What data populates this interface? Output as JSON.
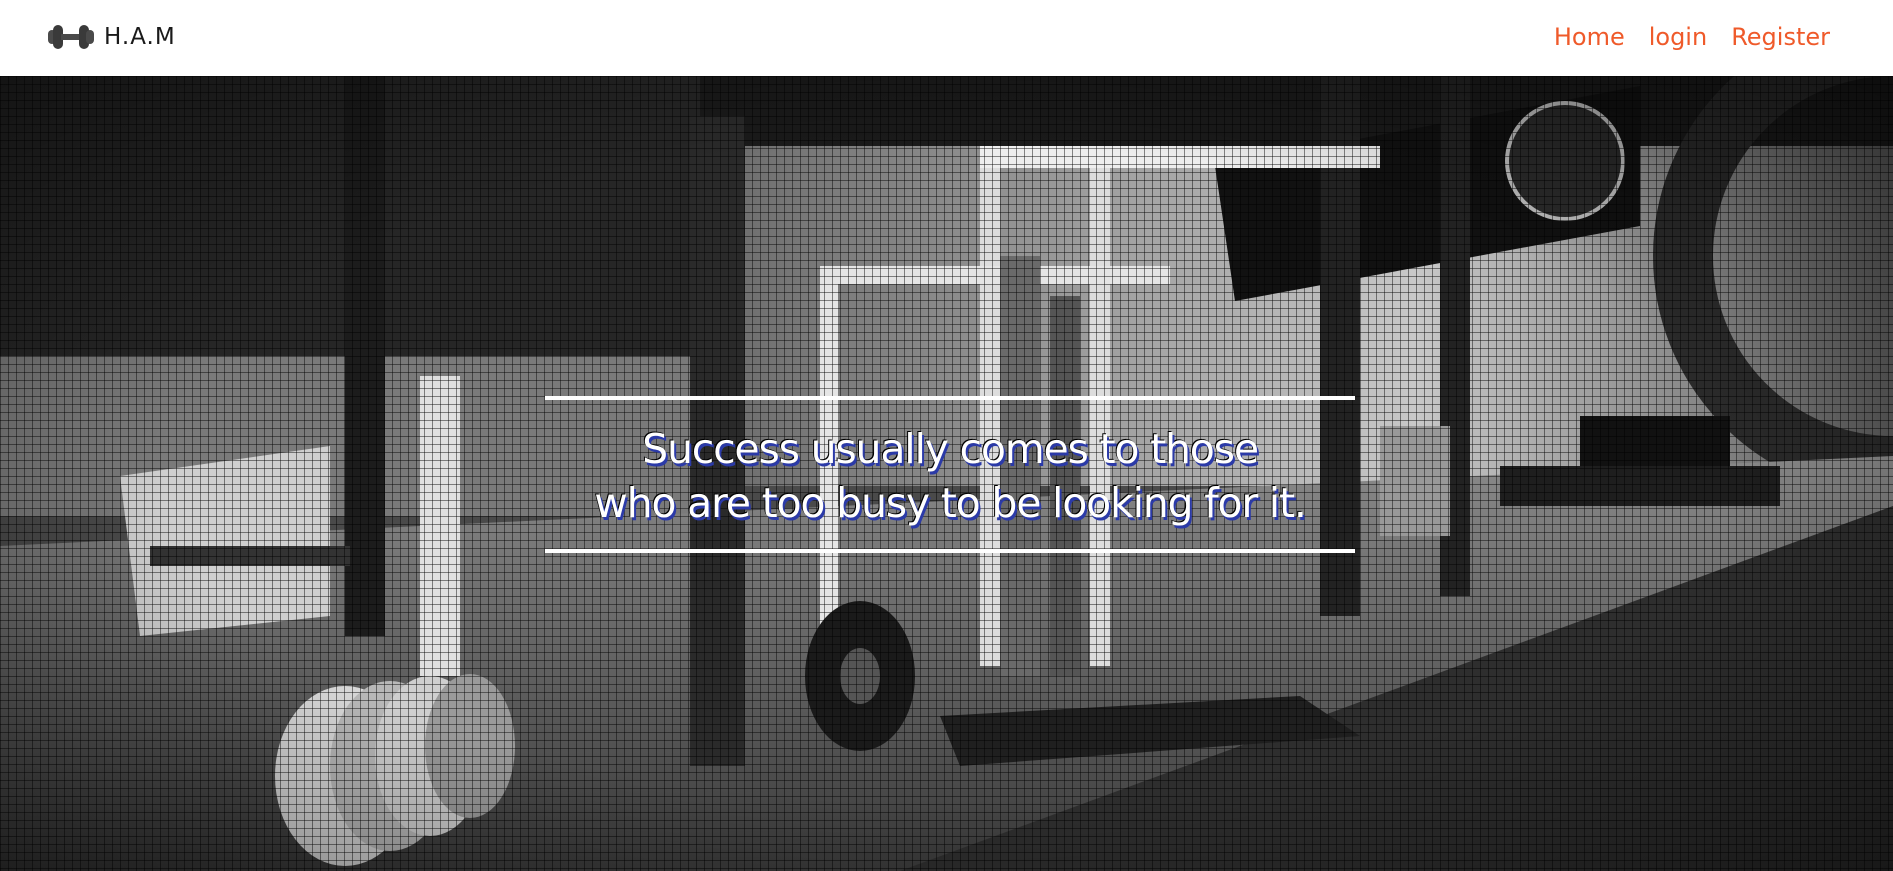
{
  "header": {
    "brand_text": "H.A.M",
    "logo_icon": "dumbbell-icon",
    "nav": [
      {
        "label": "Home"
      },
      {
        "label": "login"
      },
      {
        "label": "Register"
      }
    ],
    "link_color": "#ef5a2a"
  },
  "hero": {
    "background": "grayscale gym photograph",
    "quote_line_1": "Success usually comes to those",
    "quote_line_2": "who are too busy to be looking for it.",
    "quote_color": "#ffffff",
    "quote_shadow_color": "#2b3aa8"
  }
}
